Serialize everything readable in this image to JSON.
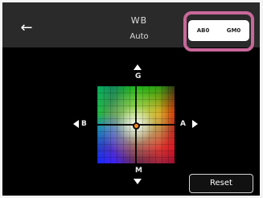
{
  "header": {
    "title": "WB",
    "subtitle": "Auto"
  },
  "value_display": {
    "ab": "AB0",
    "gm": "GM0"
  },
  "axes": {
    "top": "G",
    "bottom": "M",
    "left": "B",
    "right": "A"
  },
  "footer": {
    "reset_label": "Reset"
  },
  "colors": {
    "highlight": "#c8689a",
    "marker": "#ff8b1f"
  },
  "icons": {
    "back": "back-arrow-icon",
    "up": "up-arrow-icon",
    "down": "down-arrow-icon",
    "left": "left-arrow-icon",
    "right": "right-arrow-icon"
  }
}
